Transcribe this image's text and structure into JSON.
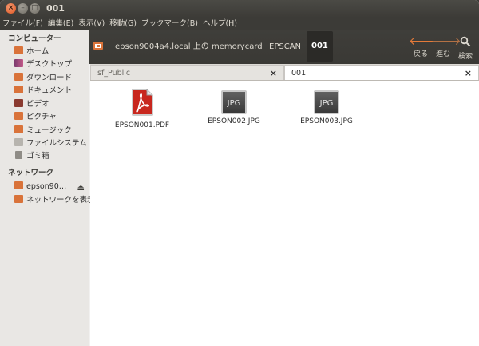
{
  "window": {
    "title": "001"
  },
  "menu": [
    "ファイル(F)",
    "編集(E)",
    "表示(V)",
    "移動(G)",
    "ブックマーク(B)",
    "ヘルプ(H)"
  ],
  "path": {
    "crumbs": [
      "epson9004a4.local 上の memorycard",
      "EPSCAN",
      "001"
    ]
  },
  "toolbar": {
    "back": "戻る",
    "forward": "進む",
    "search": "検索"
  },
  "sidebar": {
    "computer_heading": "コンピューター",
    "computer_items": [
      {
        "label": "ホーム",
        "icon": "home-icon",
        "color": "#d9733a"
      },
      {
        "label": "デスクトップ",
        "icon": "desktop-icon",
        "color": "#7c3b6e"
      },
      {
        "label": "ダウンロード",
        "icon": "download-folder-icon",
        "color": "#d9733a"
      },
      {
        "label": "ドキュメント",
        "icon": "documents-folder-icon",
        "color": "#d9733a"
      },
      {
        "label": "ビデオ",
        "icon": "video-folder-icon",
        "color": "#8a3a2f"
      },
      {
        "label": "ピクチャ",
        "icon": "pictures-folder-icon",
        "color": "#d9733a"
      },
      {
        "label": "ミュージック",
        "icon": "music-folder-icon",
        "color": "#d9733a"
      },
      {
        "label": "ファイルシステム",
        "icon": "filesystem-icon",
        "color": "#9c9a95"
      },
      {
        "label": "ゴミ箱",
        "icon": "trash-icon",
        "color": "#8f8c86"
      }
    ],
    "network_heading": "ネットワーク",
    "network_items": [
      {
        "label": "epson90…",
        "icon": "network-share-icon",
        "color": "#d9733a",
        "eject": true
      },
      {
        "label": "ネットワークを表示",
        "icon": "network-icon",
        "color": "#d9733a"
      }
    ]
  },
  "tabs": [
    {
      "label": "sf_Public",
      "active": false
    },
    {
      "label": "001",
      "active": true
    }
  ],
  "files": [
    {
      "name": "EPSON001.PDF",
      "type": "pdf"
    },
    {
      "name": "EPSON002.JPG",
      "type": "jpg",
      "badge": "JPG"
    },
    {
      "name": "EPSON003.JPG",
      "type": "jpg",
      "badge": "JPG"
    }
  ]
}
